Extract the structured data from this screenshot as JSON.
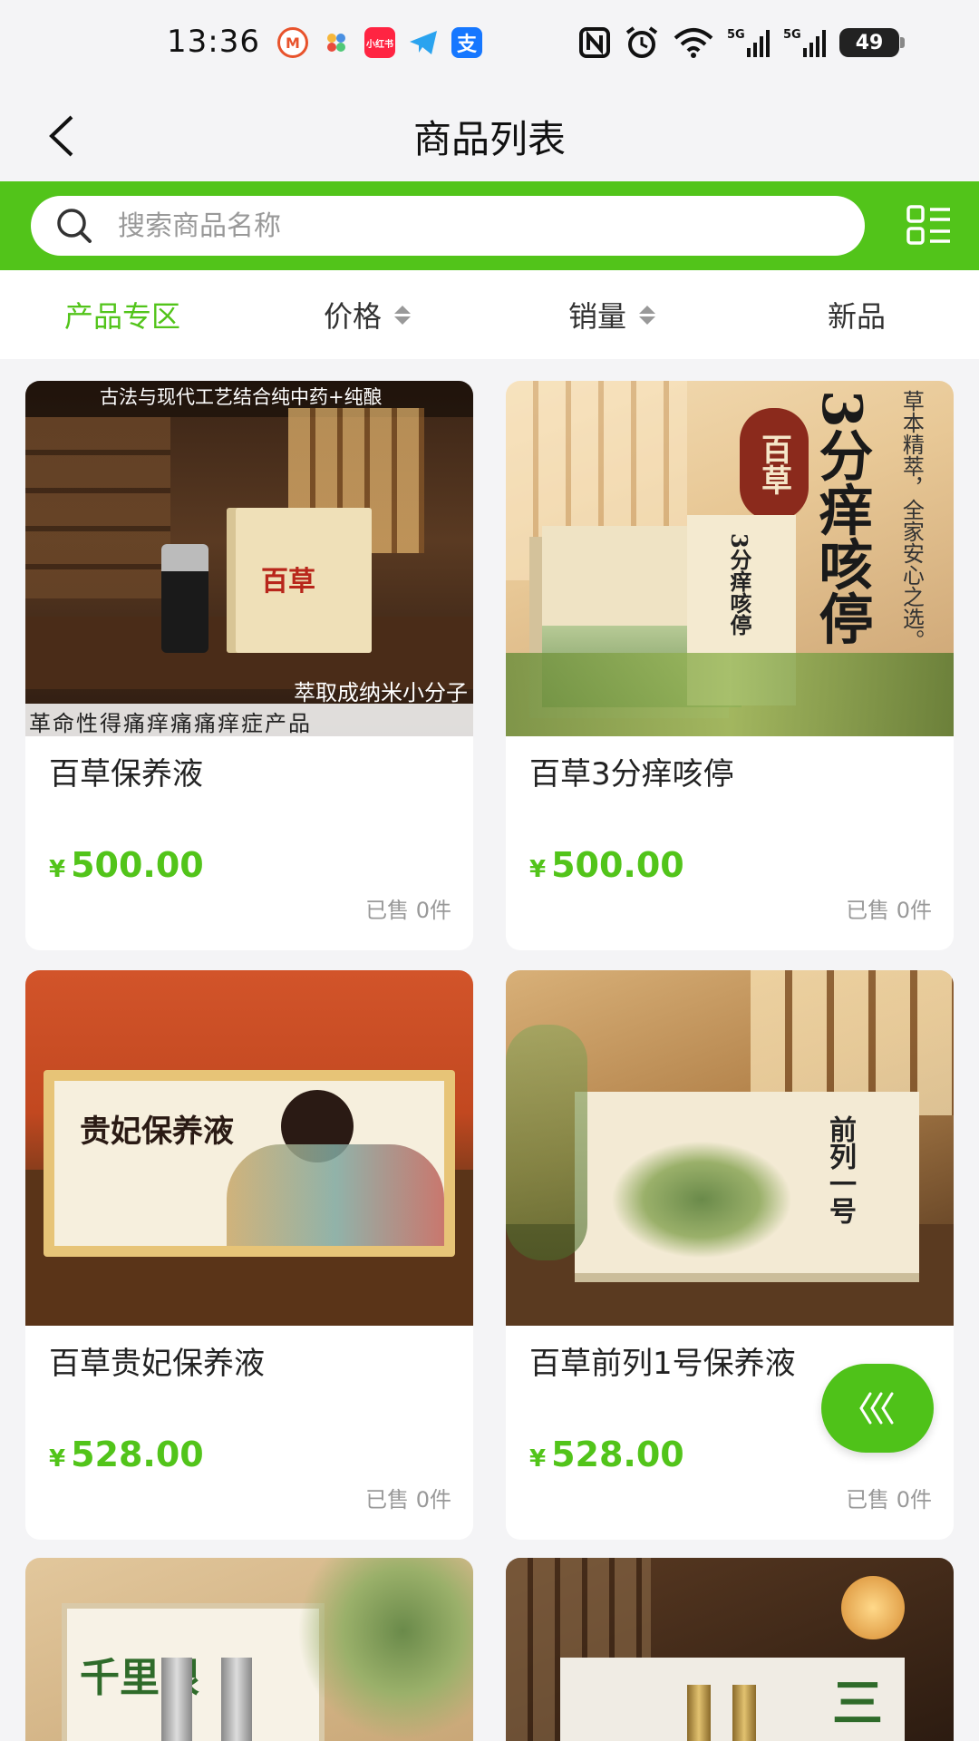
{
  "status_bar": {
    "time": "13:36",
    "app_icons": [
      {
        "name": "metro-icon",
        "color": "#e8532c",
        "glyph": "M"
      },
      {
        "name": "petal-icon",
        "color": "#f4f4f6",
        "glyph": "✿"
      },
      {
        "name": "xiaohongshu-icon",
        "color": "#ff2442",
        "glyph": "小红书"
      },
      {
        "name": "telegram-icon",
        "color": "#2aa3ef",
        "glyph": "➤"
      },
      {
        "name": "alipay-icon",
        "color": "#1677ff",
        "glyph": "支"
      }
    ],
    "battery": "49"
  },
  "header": {
    "title": "商品列表"
  },
  "search": {
    "placeholder": "搜索商品名称"
  },
  "sort_tabs": [
    {
      "label": "产品专区",
      "active": true,
      "sortable": false
    },
    {
      "label": "价格",
      "active": false,
      "sortable": true
    },
    {
      "label": "销量",
      "active": false,
      "sortable": true
    },
    {
      "label": "新品",
      "active": false,
      "sortable": false
    }
  ],
  "products": [
    {
      "name": "百草保养液",
      "currency": "¥",
      "price": "500.00",
      "sold": "已售 0件",
      "image_top_text": "古法与现代工艺结合纯中药+纯酿",
      "image_bottom_text_1": "萃取成纳米小分子",
      "image_bottom_text_2": "革命性得痛痒痛痛痒症产品",
      "box_label": "百草"
    },
    {
      "name": "百草3分痒咳停",
      "currency": "¥",
      "price": "500.00",
      "sold": "已售 0件",
      "seal_text": "百草",
      "headline": "3分痒咳停",
      "side_text": "草本精萃，全家安心之选。",
      "box_label": "3分痒咳停"
    },
    {
      "name": "百草贵妃保养液",
      "currency": "¥",
      "price": "528.00",
      "sold": "已售 0件",
      "box_label": "贵妃保养液"
    },
    {
      "name": "百草前列1号保养液",
      "currency": "¥",
      "price": "528.00",
      "sold": "已售 0件",
      "box_label": "前列一号"
    }
  ],
  "partial_products": [
    {
      "box_label": "千里眼"
    },
    {
      "box_label": "三"
    }
  ],
  "colors": {
    "accent": "#52c41a",
    "background": "#f4f4f6",
    "card": "#ffffff"
  }
}
